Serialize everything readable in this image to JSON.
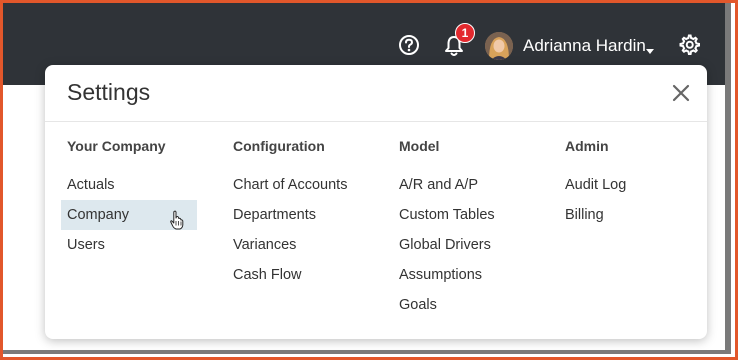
{
  "topbar": {
    "notification_count": "1",
    "user_name": "Adrianna Hardin",
    "icons": [
      "help-icon",
      "bell-icon",
      "caret-down-icon",
      "gear-icon"
    ],
    "background_color": "#2f3338",
    "badge_color": "#e3292e"
  },
  "settings": {
    "title": "Settings",
    "columns": [
      {
        "heading": "Your Company",
        "items": [
          "Actuals",
          "Company",
          "Users"
        ]
      },
      {
        "heading": "Configuration",
        "items": [
          "Chart of Accounts",
          "Departments",
          "Variances",
          "Cash Flow"
        ]
      },
      {
        "heading": "Model",
        "items": [
          "A/R and A/P",
          "Custom Tables",
          "Global Drivers",
          "Assumptions",
          "Goals"
        ]
      },
      {
        "heading": "Admin",
        "items": [
          "Audit Log",
          "Billing"
        ]
      }
    ],
    "highlighted_item": "Company",
    "highlight_color": "#dde8ee"
  },
  "frame": {
    "border_color": "#e2572b"
  }
}
